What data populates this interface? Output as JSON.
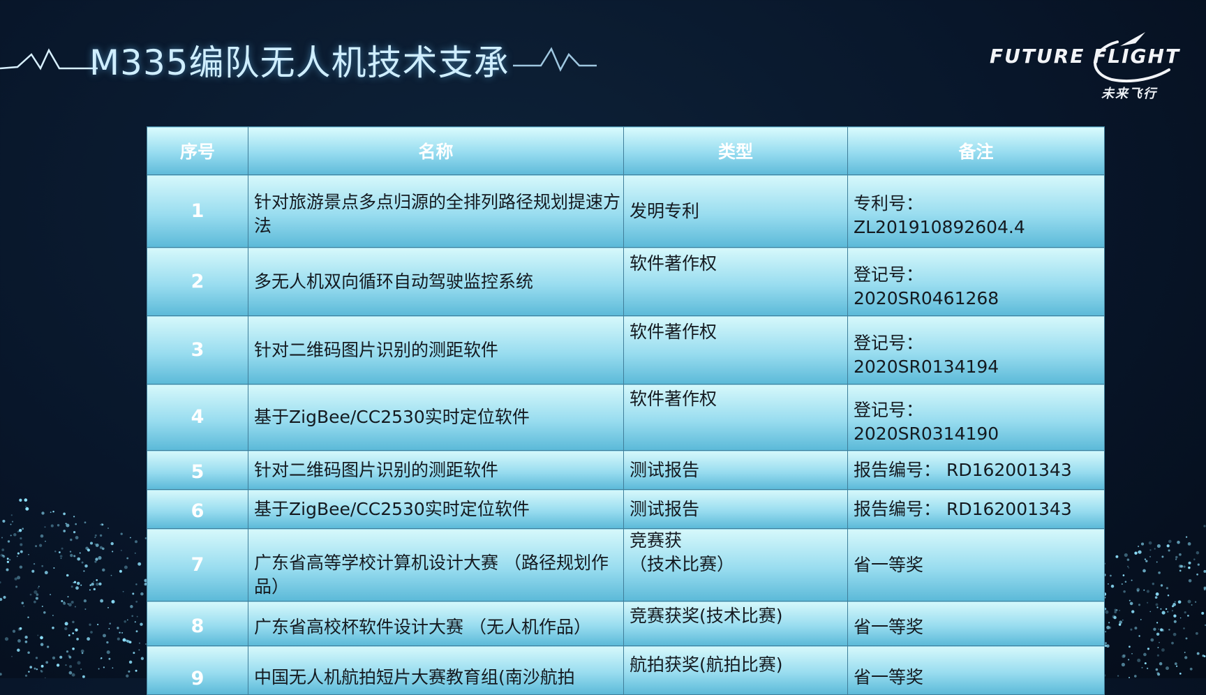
{
  "slide": {
    "title": "M335编队无人机技术支承"
  },
  "logo": {
    "text": "FUTURE  FLIGHT",
    "subtitle": "未来飞行"
  },
  "table": {
    "headers": {
      "index": "序号",
      "name": "名称",
      "type": "类型",
      "note": "备注"
    },
    "rows": [
      {
        "index": "1",
        "name": "针对旅游景点多点归源的全排列路径规划提速方法",
        "type": "发明专利",
        "note": "专利号：\nZL201910892604.4"
      },
      {
        "index": "2",
        "name": "多无人机双向循环自动驾驶监控系统",
        "type": "软件著作权",
        "note": "登记号：\n2020SR0461268"
      },
      {
        "index": "3",
        "name": "针对二维码图片识别的测距软件",
        "type": "软件著作权",
        "note": "登记号：\n2020SR0134194"
      },
      {
        "index": "4",
        "name": "基于ZigBee/CC2530实时定位软件",
        "type": "软件著作权",
        "note": "登记号：\n2020SR0314190"
      },
      {
        "index": "5",
        "name": "针对二维码图片识别的测距软件",
        "type": "测试报告",
        "note": "报告编号：  RD162001343"
      },
      {
        "index": "6",
        "name": "基于ZigBee/CC2530实时定位软件",
        "type": "测试报告",
        "note": "报告编号：  RD162001343"
      },
      {
        "index": "7",
        "name": "广东省高等学校计算机设计大赛 （路径规划作品）",
        "type": "竞赛获\n（技术比赛）",
        "note": "省一等奖"
      },
      {
        "index": "8",
        "name": "广东省高校杯软件设计大赛 （无人机作品）",
        "type": "竞赛获奖(技术比赛)",
        "note": "省一等奖"
      },
      {
        "index": "9",
        "name": "中国无人机航拍短片大赛教育组(南沙航拍",
        "type": "航拍获奖(航拍比赛)",
        "note": "省一等奖"
      }
    ]
  },
  "colors": {
    "background": "#08162a",
    "title_glow": "#6ec8ff",
    "table_light": "#d6f8fb",
    "table_dark": "#5bb9d8",
    "particles": "#8fe3ff"
  },
  "icons": {
    "pulse_left": "heartbeat-line-icon",
    "pulse_right": "heartbeat-line-icon",
    "logo_swoosh": "flight-swoosh-icon"
  }
}
